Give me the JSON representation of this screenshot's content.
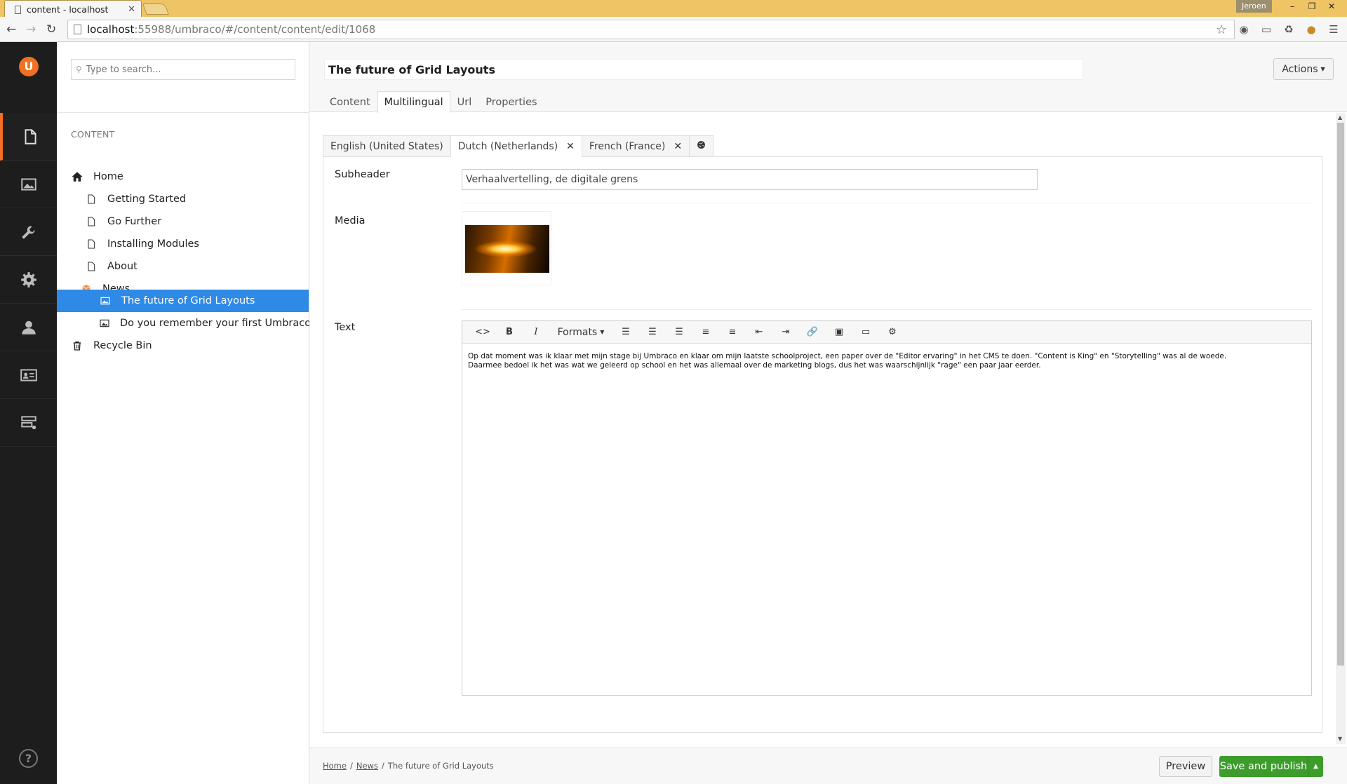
{
  "browser": {
    "tab_title": "content - localhost",
    "tab_close": "✕",
    "profile_name": "Jeroen",
    "url_host": "localhost",
    "url_path": ":55988/umbraco/#/content/content/edit/1068"
  },
  "tree": {
    "search_placeholder": "Type to search...",
    "heading": "CONTENT",
    "nodes": [
      {
        "label": "Home",
        "icon": "home-icon"
      },
      {
        "label": "Getting Started",
        "icon": "document-icon"
      },
      {
        "label": "Go Further",
        "icon": "document-icon"
      },
      {
        "label": "Installing Modules",
        "icon": "document-icon"
      },
      {
        "label": "About",
        "icon": "document-icon"
      },
      {
        "label": "News",
        "icon": "box-icon"
      },
      {
        "label": "The future of Grid Layouts",
        "icon": "picture-icon",
        "selected": true
      },
      {
        "label": "Do you remember your first Umbraco?",
        "icon": "picture-icon"
      },
      {
        "label": "Recycle Bin",
        "icon": "trash-icon"
      }
    ]
  },
  "editor": {
    "page_name": "The future of Grid Layouts",
    "actions_label": "Actions",
    "tabs": [
      "Content",
      "Multilingual",
      "Url",
      "Properties"
    ],
    "active_tab": "Multilingual",
    "languages": [
      {
        "label": "English (United States)"
      },
      {
        "label": "Dutch (Netherlands)",
        "close": "✕"
      },
      {
        "label": "French (France)",
        "close": "✕"
      }
    ],
    "properties": {
      "subheader_label": "Subheader",
      "subheader_value": "Verhaalvertelling, de digitale grens",
      "media_label": "Media",
      "text_label": "Text",
      "formats_label": "Formats",
      "text_line1": "Op dat moment was ik klaar met mijn stage bij Umbraco en klaar om mijn laatste schoolproject, een paper over de \"Editor ervaring\" in het CMS te doen. \"Content is King\" en \"Storytelling\" was al de woede.",
      "text_line2": "Daarmee bedoel ik het was wat we geleerd op school en het was allemaal over de marketing blogs, dus het was waarschijnlijk \"rage\" een paar jaar eerder."
    }
  },
  "footer": {
    "breadcrumb": [
      "Home",
      "News",
      "The future of Grid Layouts"
    ],
    "separator": "/",
    "preview_label": "Preview",
    "publish_label": "Save and publish"
  },
  "colors": {
    "accent": "#f36f21",
    "selected": "#2e8ae6",
    "publish": "#3d9d2b",
    "sidebar": "#1d1d1d"
  }
}
